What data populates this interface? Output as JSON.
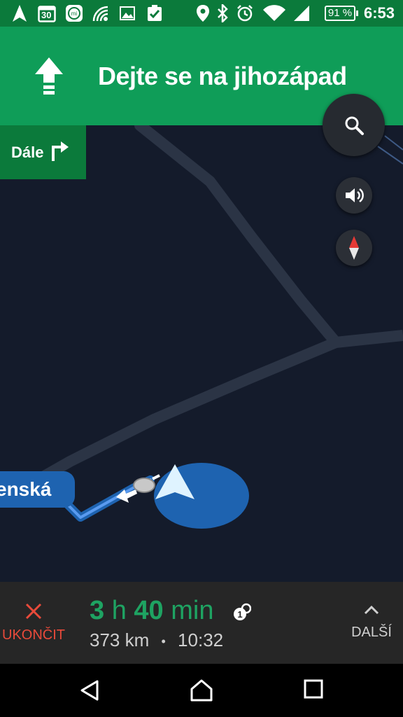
{
  "status_bar": {
    "calendar_date": "30",
    "battery": "91 %",
    "time": "6:53",
    "icons": [
      "navigation-icon",
      "calendar-icon",
      "mi-icon",
      "nfc-icon",
      "image-icon",
      "clipboard-check-icon",
      "location-icon",
      "bluetooth-icon",
      "alarm-icon",
      "wifi-icon",
      "signal-icon",
      "battery-icon"
    ]
  },
  "navigation": {
    "instruction": "Dejte se na jihozápad",
    "then_label": "Dále"
  },
  "map": {
    "street_label": "enská"
  },
  "trip": {
    "eta_hours": "3",
    "hours_unit": "h",
    "eta_minutes": "40",
    "minutes_unit": "min",
    "traffic_badge": "1",
    "distance": "373 km",
    "separator": "•",
    "arrival_time": "10:32",
    "exit_label": "UKONČIT",
    "more_label": "DALŠÍ"
  },
  "colors": {
    "header_green": "#0f9d58",
    "status_green": "#0b7a3b",
    "eta_green": "#1ea362",
    "exit_red": "#e94a3a",
    "route_blue": "#1e63b0",
    "map_bg": "#141b2b"
  }
}
